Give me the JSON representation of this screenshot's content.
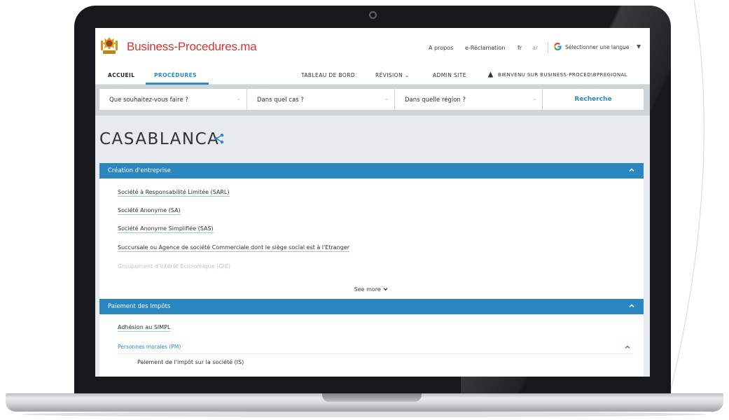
{
  "header": {
    "brand_name": "Business-Procedures",
    "brand_tld": ".ma",
    "links": [
      "A propos",
      "e-Réclamation",
      "fr",
      "ar"
    ],
    "language_selector": "Sélectionner une langue",
    "language_caret": "▼"
  },
  "nav": {
    "items": [
      "ACCUEIL",
      "PROCÉDURES",
      "TABLEAU DE BORD",
      "RÉVISION",
      "ADMIN SITE"
    ],
    "revision_caret": "⌄",
    "welcome": "BIENVENU SUR BUSINESS-PROCED\\BPREGIONAL"
  },
  "search": {
    "what": "Que souhaitez-vous faire ?",
    "case": "Dans quel cas ?",
    "region": "Dans quelle région ?",
    "submit": "Recherche"
  },
  "page": {
    "city": "CASABLANCA"
  },
  "sections": [
    {
      "title": "Création d'entreprise",
      "items": [
        "Société à Responsabilité Limitée (SARL)",
        "Société Anonyme (SA)",
        "Société Anonyme Simplifiée (SAS)",
        "Succursale ou Agence de société Commerciale dont le siège social est à l'Etranger",
        "Groupement d'Intérêt Economique (GIE)"
      ],
      "see_more": "See more"
    },
    {
      "title": "Paiement des Impôts",
      "items": [
        "Adhésion au SIMPL"
      ],
      "subgroup": {
        "title": "Personnes morales (PM)",
        "items": [
          "Paiement de l'impôt sur la société (IS)"
        ]
      }
    }
  ],
  "colors": {
    "brand_red": "#e0322d",
    "accent_blue": "#2a86bf",
    "bezel": "#17181b"
  }
}
